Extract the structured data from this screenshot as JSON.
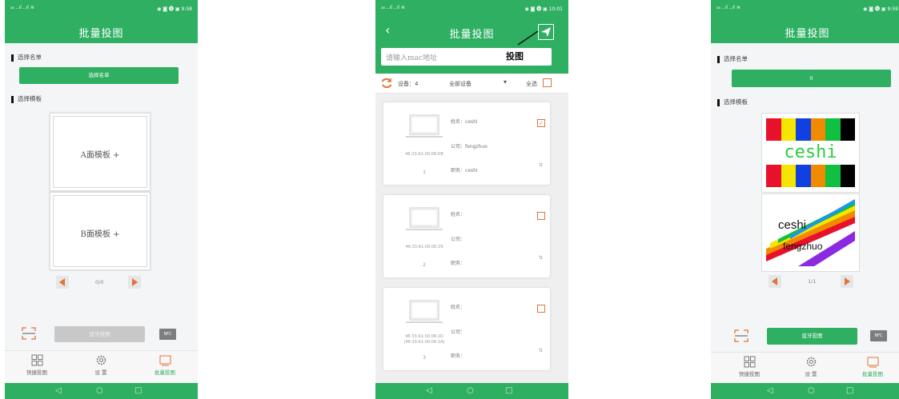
{
  "status": {
    "left": "₃₈ ..ıl ..ıl ≋",
    "right_p1": "◉ ◙ 🅝 ▣ 9:58",
    "right_p2": "◉ ◙ 🅝 ▣ 10:01",
    "right_p3": "◉ ◙ 🅝 ▣ 9:59"
  },
  "screens": {
    "p1": {
      "title": "批量投图",
      "select_list_heading": "选择名单",
      "select_list_button": "选择名单",
      "select_template_heading": "选择模板",
      "template_a": "A面模板 +",
      "template_b": "B面模板 +",
      "pager": "0/0",
      "bluetooth_button": "蓝牙投图",
      "nfc": "NFC"
    },
    "p2": {
      "title": "批量投图",
      "annotation": "投图",
      "search_placeholder": "请输入mac地址",
      "device_count": "设备：4",
      "device_filter": "全部设备",
      "select_all": "全选",
      "devices": [
        {
          "mac": "46:33:A1:00:06:D8",
          "mac2": "",
          "index": "1",
          "name_label": "姓名：",
          "name": "ceshi",
          "company_label": "公司：",
          "company": "fengzhuo",
          "role_label": "职务：",
          "role": "ceshi",
          "checked": "✓"
        },
        {
          "mac": "46:33:A1:00:06:29",
          "mac2": "",
          "index": "2",
          "name_label": "姓名：",
          "name": "",
          "company_label": "公司：",
          "company": "",
          "role_label": "职务：",
          "role": "",
          "checked": ""
        },
        {
          "mac": "46:33:A1:00:06:1D",
          "mac2": "(46:33:A1:00:06:1A)",
          "index": "3",
          "name_label": "姓名：",
          "name": "",
          "company_label": "公司：",
          "company": "",
          "role_label": "职务：",
          "role": "",
          "checked": ""
        }
      ]
    },
    "p3": {
      "title": "批量投图",
      "select_list_heading": "选择名单",
      "selected_count": "0",
      "select_template_heading": "选择模板",
      "card_a_text": "ceshi",
      "card_b_name": "ceshi",
      "card_b_company": "fengzhuo",
      "pager": "1/1",
      "bluetooth_button": "蓝牙投图",
      "nfc": "NFC"
    }
  },
  "tabs": [
    "快捷投图",
    "设 置",
    "批量投图"
  ],
  "colors": {
    "brand_green": "#2eaf62",
    "accent_orange": "#e0743a",
    "stripes": [
      "#e8102a",
      "#f5e600",
      "#1040e0",
      "#f08a00",
      "#10c040",
      "#000000"
    ]
  }
}
